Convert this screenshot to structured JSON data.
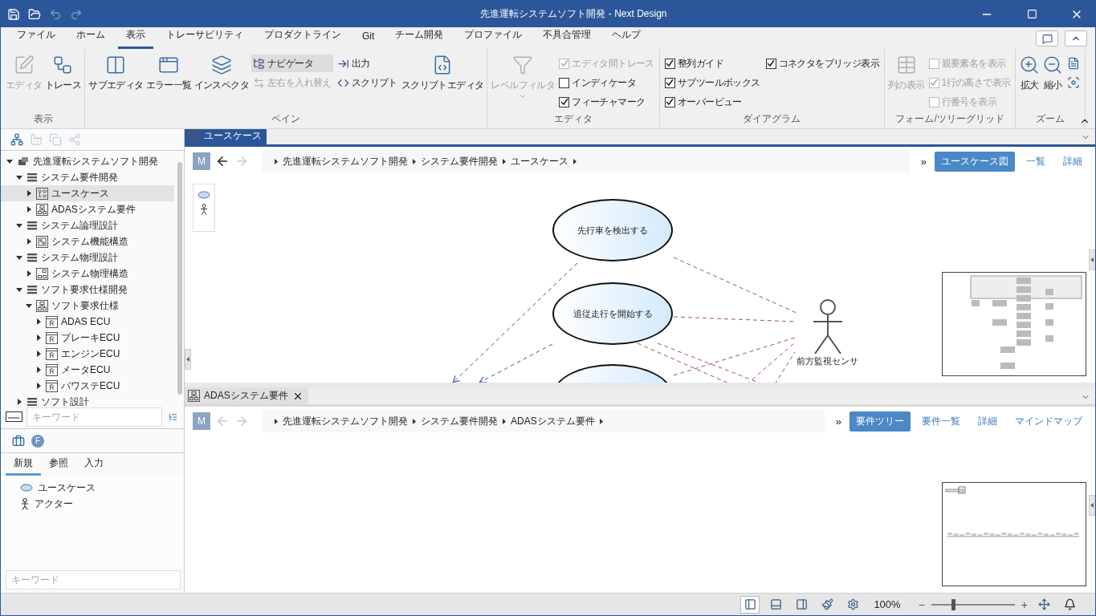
{
  "window": {
    "title": "先進運転システムソフト開発 - Next Design"
  },
  "menu": [
    {
      "label": "ファイル",
      "selected": false
    },
    {
      "label": "ホーム",
      "selected": false
    },
    {
      "label": "表示",
      "selected": true
    },
    {
      "label": "トレーサビリティ",
      "selected": false
    },
    {
      "label": "プロダクトライン",
      "selected": false
    },
    {
      "label": "Git",
      "selected": false
    },
    {
      "label": "チーム開発",
      "selected": false
    },
    {
      "label": "プロファイル",
      "selected": false
    },
    {
      "label": "不具合管理",
      "selected": false
    },
    {
      "label": "ヘルプ",
      "selected": false
    }
  ],
  "ribbon": [
    {
      "label": "表示",
      "items": [
        {
          "kind": "large",
          "label": "エディタ",
          "disabled": true,
          "selected": false
        },
        {
          "kind": "large",
          "label": "トレース",
          "disabled": false,
          "selected": false
        }
      ]
    },
    {
      "label": "ペイン",
      "items": [
        {
          "kind": "large",
          "label": "サブエディタ",
          "disabled": false,
          "selected": false
        },
        {
          "kind": "large",
          "label": "エラー一覧",
          "disabled": false,
          "selected": false
        },
        {
          "kind": "large",
          "label": "インスペクタ",
          "disabled": false,
          "selected": false
        },
        {
          "kind": "stack",
          "items": [
            {
              "kind": "small",
              "label": "ナビゲータ",
              "disabled": false,
              "selected": true
            },
            {
              "kind": "small",
              "label": "左右を入れ替え",
              "disabled": true,
              "selected": false
            }
          ]
        },
        {
          "kind": "stack",
          "items": [
            {
              "kind": "small",
              "label": "出力",
              "disabled": false,
              "selected": false
            },
            {
              "kind": "small",
              "label": "スクリプト",
              "disabled": false,
              "selected": false
            }
          ]
        },
        {
          "kind": "large",
          "label": "スクリプトエディタ",
          "disabled": false,
          "selected": false
        }
      ]
    },
    {
      "label": "エディタ",
      "items": [
        {
          "kind": "large",
          "label": "レベルフィルタ",
          "disabled": true,
          "selected": false
        },
        {
          "kind": "stack",
          "items": [
            {
              "kind": "check",
              "label": "エディタ間トレース",
              "checked": true,
              "disabled": true
            },
            {
              "kind": "check",
              "label": "インディケータ",
              "checked": false,
              "disabled": false
            },
            {
              "kind": "check",
              "label": "フィーチャマーク",
              "checked": true,
              "disabled": false
            }
          ]
        }
      ]
    },
    {
      "label": "ダイアグラム",
      "items": [
        {
          "kind": "stack",
          "items": [
            {
              "kind": "check",
              "label": "整列ガイド",
              "checked": true,
              "disabled": false
            },
            {
              "kind": "check",
              "label": "サブツールボックス",
              "checked": true,
              "disabled": false
            },
            {
              "kind": "check",
              "label": "オーバービュー",
              "checked": true,
              "disabled": false
            }
          ]
        },
        {
          "kind": "stack",
          "items": [
            {
              "kind": "check",
              "label": "コネクタをブリッジ表示",
              "checked": true,
              "disabled": false
            }
          ]
        }
      ]
    },
    {
      "label": "フォーム/ツリーグリッド",
      "items": [
        {
          "kind": "large",
          "label": "列の表示",
          "disabled": true,
          "selected": false
        },
        {
          "kind": "stack",
          "items": [
            {
              "kind": "check",
              "label": "親要素名を表示",
              "checked": false,
              "disabled": true
            },
            {
              "kind": "check",
              "label": "1行の高さで表示",
              "checked": true,
              "disabled": true
            },
            {
              "kind": "check",
              "label": "行番号を表示",
              "checked": false,
              "disabled": true
            }
          ]
        }
      ]
    },
    {
      "label": "ズーム",
      "items": [
        {
          "kind": "large",
          "label": "拡大",
          "disabled": false,
          "selected": false
        },
        {
          "kind": "large",
          "label": "縮小",
          "disabled": false,
          "selected": false
        },
        {
          "kind": "stack",
          "items": [
            {
              "kind": "icon",
              "disabled": false
            },
            {
              "kind": "icon",
              "disabled": false
            }
          ]
        }
      ]
    }
  ],
  "navigator": {
    "tree": [
      {
        "label": "先進運転システムソフト開発",
        "kind": "project",
        "expanded": true,
        "selected": false,
        "children": [
          {
            "label": "システム要件開発",
            "kind": "folder",
            "expanded": true,
            "selected": false,
            "children": [
              {
                "label": "ユースケース",
                "kind": "usecase",
                "expanded": false,
                "selected": true
              },
              {
                "label": "ADASシステム要件",
                "kind": "model",
                "expanded": false,
                "selected": false
              }
            ]
          },
          {
            "label": "システム論理設計",
            "kind": "folder",
            "expanded": true,
            "selected": false,
            "children": [
              {
                "label": "システム機能構造",
                "kind": "logical",
                "expanded": false,
                "selected": false
              }
            ]
          },
          {
            "label": "システム物理設計",
            "kind": "folder",
            "expanded": true,
            "selected": false,
            "children": [
              {
                "label": "システム物理構造",
                "kind": "physical",
                "expanded": false,
                "selected": false
              }
            ]
          },
          {
            "label": "ソフト要求仕様開発",
            "kind": "folder",
            "expanded": true,
            "selected": false,
            "children": [
              {
                "label": "ソフト要求仕様",
                "kind": "model",
                "expanded": true,
                "selected": false,
                "children": [
                  {
                    "label": "ADAS ECU",
                    "kind": "requirement",
                    "expanded": false,
                    "selected": false
                  },
                  {
                    "label": "ブレーキECU",
                    "kind": "requirement",
                    "expanded": false,
                    "selected": false
                  },
                  {
                    "label": "エンジンECU",
                    "kind": "requirement",
                    "expanded": false,
                    "selected": false
                  },
                  {
                    "label": "メータECU",
                    "kind": "requirement",
                    "expanded": false,
                    "selected": false
                  },
                  {
                    "label": "パワステECU",
                    "kind": "requirement",
                    "expanded": false,
                    "selected": false
                  }
                ]
              }
            ]
          },
          {
            "label": "ソフト設計",
            "kind": "folder",
            "expanded": false,
            "selected": false
          }
        ]
      }
    ],
    "search": {
      "placeholder": "キーワード"
    }
  },
  "toolbox": {
    "badge": "F",
    "tabs": [
      {
        "label": "新規",
        "selected": true
      },
      {
        "label": "参照",
        "selected": false
      },
      {
        "label": "入力",
        "selected": false
      }
    ],
    "items": [
      {
        "label": "ユースケース",
        "kind": "usecase"
      },
      {
        "label": "アクター",
        "kind": "actor"
      }
    ],
    "search": {
      "placeholder": "キーワード"
    }
  },
  "editors": [
    {
      "kind": "diagram",
      "tab": {
        "label": "ユースケース",
        "selected": true,
        "closable": false
      },
      "mode": "M",
      "back_enabled": true,
      "forward_enabled": false,
      "breadcrumb": [
        "先進運転システムソフト開発",
        "システム要件開発",
        "ユースケース"
      ],
      "more": "»",
      "views": [
        {
          "label": "ユースケース図",
          "selected": true
        },
        {
          "label": "一覧",
          "selected": false
        },
        {
          "label": "詳細",
          "selected": false
        }
      ],
      "nodes": [
        {
          "kind": "usecase",
          "label": "先行車を検出する"
        },
        {
          "kind": "usecase",
          "label": "追従走行を開始する"
        },
        {
          "kind": "usecase"
        },
        {
          "kind": "actor",
          "label": "前方監視センサ"
        }
      ]
    },
    {
      "kind": "blank",
      "tab": {
        "label": "ADASシステム要件",
        "selected": false,
        "closable": true
      },
      "mode": "M",
      "back_enabled": false,
      "forward_enabled": false,
      "breadcrumb": [
        "先進運転システムソフト開発",
        "システム要件開発",
        "ADASシステム要件"
      ],
      "more": "»",
      "views": [
        {
          "label": "要件ツリー",
          "selected": true
        },
        {
          "label": "要件一覧",
          "selected": false
        },
        {
          "label": "詳細",
          "selected": false
        },
        {
          "label": "マインドマップ",
          "selected": false
        }
      ]
    }
  ],
  "status_bar": {
    "layouts": [
      {
        "selected": true
      },
      {
        "selected": false
      },
      {
        "selected": false
      }
    ],
    "zoom": {
      "reading": "100%",
      "minus": "−",
      "plus": "+",
      "level": 0.26
    }
  }
}
